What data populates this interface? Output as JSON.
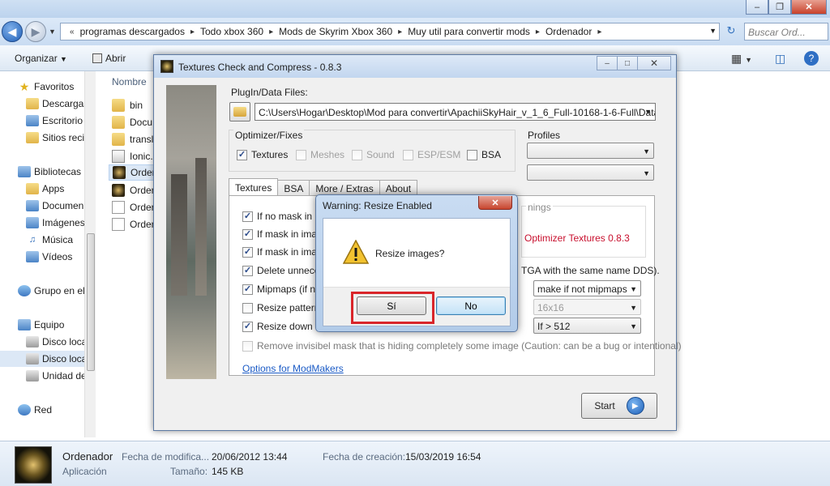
{
  "explorer": {
    "breadcrumbs": [
      "programas descargados",
      "Todo xbox 360",
      "Mods de Skyrim Xbox 360",
      "Muy util para convertir mods",
      "Ordenador"
    ],
    "search_placeholder": "Buscar Ord...",
    "toolbar": {
      "organize": "Organizar",
      "open": "Abrir"
    },
    "nav": {
      "favorites": "Favoritos",
      "favorites_items": [
        "Descargas",
        "Escritorio",
        "Sitios reci"
      ],
      "libraries": "Bibliotecas",
      "library_items": [
        "Apps",
        "Documen",
        "Imágenes",
        "Música",
        "Vídeos"
      ],
      "homegroup": "Grupo en el",
      "computer": "Equipo",
      "computer_items": [
        "Disco loca",
        "Disco loca",
        "Unidad de"
      ],
      "network": "Red"
    },
    "file_list": {
      "column_name": "Nombre",
      "items": [
        "bin",
        "Docu",
        "transl",
        "Ionic.",
        "Orden",
        "Orden",
        "Orden",
        "Orden"
      ]
    },
    "details": {
      "name": "Ordenador",
      "type": "Aplicación",
      "modified_label": "Fecha de modifica...",
      "modified_value": "20/06/2012 13:44",
      "size_label": "Tamaño:",
      "size_value": "145 KB",
      "created_label": "Fecha de creación:",
      "created_value": "15/03/2019 16:54"
    }
  },
  "app": {
    "title": "Textures Check and Compress - 0.8.3",
    "plugin_label": "PlugIn/Data Files:",
    "path": "C:\\Users\\Hogar\\Desktop\\Mod para convertir\\ApachiiSkyHair_v_1_6_Full-10168-1-6-Full\\Data\\text",
    "optimizer_label": "Optimizer/Fixes",
    "optimizer_options": [
      {
        "label": "Textures",
        "checked": "✓"
      },
      {
        "label": "Meshes",
        "checked": ""
      },
      {
        "label": "Sound",
        "checked": ""
      },
      {
        "label": "ESP/ESM",
        "checked": ""
      },
      {
        "label": "BSA",
        "checked": ""
      }
    ],
    "profiles_label": "Profiles",
    "tabs": [
      "Textures",
      "BSA",
      "More / Extras",
      "About"
    ],
    "texture_options": [
      {
        "label": "If no mask in im",
        "checked": "✓"
      },
      {
        "label": "If mask in image",
        "checked": "✓"
      },
      {
        "label": "If mask in image",
        "checked": "✓"
      },
      {
        "label": "Delete unneces",
        "checked": "✓"
      },
      {
        "label": "Mipmaps (if not",
        "checked": "✓"
      },
      {
        "label": "Resize patterns",
        "checked": ""
      },
      {
        "label": "Resize down (re",
        "checked": "✓"
      }
    ],
    "remove_mask_option": "Remove invisibel mask that is hiding completely some image (Caution: can be a bug or intentional)",
    "warnings_label": "nings",
    "version_text": "Optimizer Textures 0.8.3",
    "tga_text": "TGA with the same name DDS).",
    "mipmaps_combo": "make if not mipmaps",
    "pattern_combo": "16x16",
    "resize_combo": "If > 512",
    "modmakers_link": "Options for ModMakers",
    "start_label": "Start"
  },
  "dialog": {
    "title": "Warning: Resize Enabled",
    "message": "Resize images?",
    "yes": "Sí",
    "no": "No"
  },
  "colors": {
    "highlight": "#d9252a",
    "version_text": "#c8102e",
    "link": "#1b5bc6"
  }
}
